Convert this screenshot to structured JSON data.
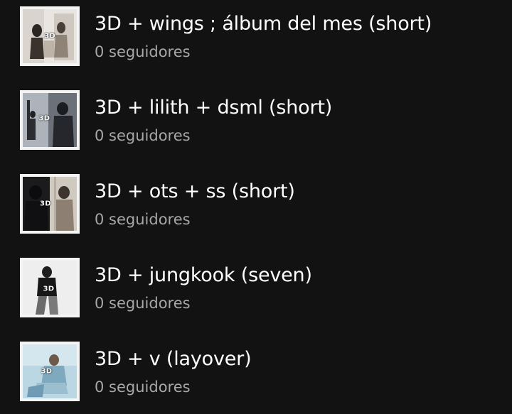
{
  "playlists": [
    {
      "title": "3D + wings ; álbum del mes (short)",
      "subtitle": "0 seguidores",
      "cover_badge": "3D",
      "cover_icon": "playlist-cover-image"
    },
    {
      "title": "3D + lilith + dsml (short)",
      "subtitle": "0 seguidores",
      "cover_badge": "3D",
      "cover_icon": "playlist-cover-image"
    },
    {
      "title": "3D + ots + ss (short)",
      "subtitle": "0 seguidores",
      "cover_badge": "3D",
      "cover_icon": "playlist-cover-image"
    },
    {
      "title": "3D + jungkook (seven)",
      "subtitle": "0 seguidores",
      "cover_badge": "3D",
      "cover_icon": "playlist-cover-image"
    },
    {
      "title": "3D + v (layover)",
      "subtitle": "0 seguidores",
      "cover_badge": "3D",
      "cover_icon": "playlist-cover-image"
    }
  ],
  "colors": {
    "background": "#121212",
    "title": "#ffffff",
    "subtitle": "#a7a7a7"
  }
}
